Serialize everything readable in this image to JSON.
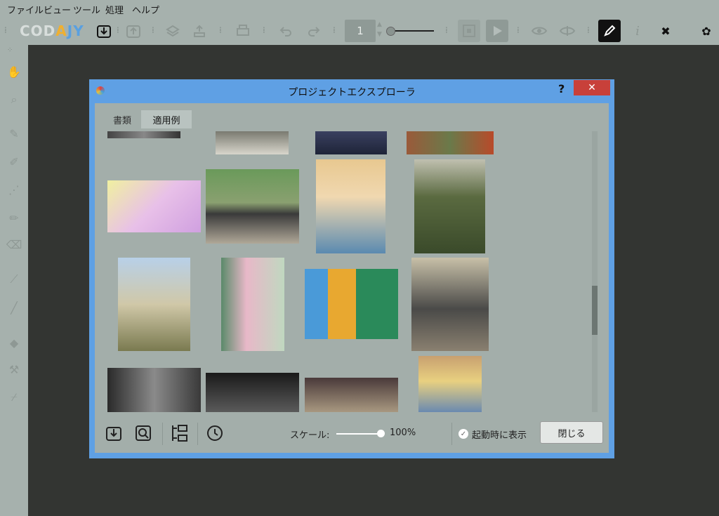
{
  "menu": [
    "ファイル",
    "ビュー",
    "ツール",
    "処理",
    "ヘルプ"
  ],
  "toolbar": {
    "logo_parts": [
      "COD",
      "A",
      "JY"
    ],
    "page_number": "1"
  },
  "dialog": {
    "title": "プロジェクトエクスプローラ",
    "help_label": "?",
    "close_glyph": "✕",
    "tabs": [
      "書類",
      "適用例"
    ],
    "scale_label": "スケール:",
    "scale_value": "100%",
    "startup_check": "✓",
    "startup_label": "起動時に表示",
    "close_label": "閉じる"
  },
  "thumbnails": [
    {
      "name": "thumb-partial-1"
    },
    {
      "name": "thumb-partial-2"
    },
    {
      "name": "thumb-partial-3"
    },
    {
      "name": "thumb-partial-4"
    },
    {
      "name": "thumb-woman-hat-purple"
    },
    {
      "name": "thumb-vintage-car"
    },
    {
      "name": "thumb-woman-straw-hat"
    },
    {
      "name": "thumb-soldiers"
    },
    {
      "name": "thumb-soldier-portrait"
    },
    {
      "name": "thumb-woman-pink-dress"
    },
    {
      "name": "thumb-colorful-buildings"
    },
    {
      "name": "thumb-train-wreck"
    },
    {
      "name": "thumb-couple"
    },
    {
      "name": "thumb-birds"
    },
    {
      "name": "thumb-meeting-room"
    },
    {
      "name": "thumb-child-blue-bow"
    }
  ]
}
